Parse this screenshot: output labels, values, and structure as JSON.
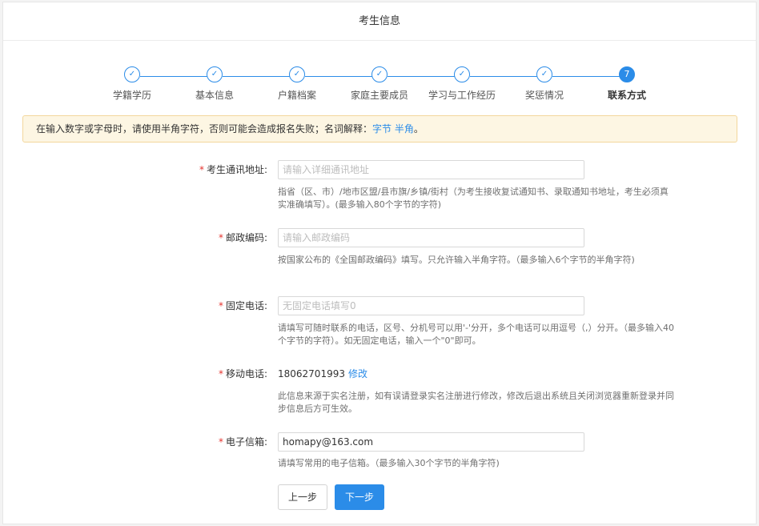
{
  "header": {
    "title": "考生信息"
  },
  "steps": [
    {
      "label": "学籍学历",
      "mark": "✓"
    },
    {
      "label": "基本信息",
      "mark": "✓"
    },
    {
      "label": "户籍档案",
      "mark": "✓"
    },
    {
      "label": "家庭主要成员",
      "mark": "✓"
    },
    {
      "label": "学习与工作经历",
      "mark": "✓"
    },
    {
      "label": "奖惩情况",
      "mark": "✓"
    },
    {
      "label": "联系方式",
      "mark": "7"
    }
  ],
  "notice": {
    "text": "在输入数字或字母时，请使用半角字符，否则可能会造成报名失败；名词解释：",
    "link1": "字节",
    "link2": "半角",
    "end": "。"
  },
  "form": {
    "required_mark": "*",
    "address": {
      "label": "考生通讯地址:",
      "placeholder": "请输入详细通讯地址",
      "hint": "指省（区、市）/地市区盟/县市旗/乡镇/街村（为考生接收复试通知书、录取通知书地址，考生必须真实准确填写）。(最多输入80个字节的字符)"
    },
    "postcode": {
      "label": "邮政编码:",
      "placeholder": "请输入邮政编码",
      "hint": "按国家公布的《全国邮政编码》填写。只允许输入半角字符。（最多输入6个字节的半角字符)"
    },
    "phone": {
      "label": "固定电话:",
      "placeholder": "无固定电话填写0",
      "hint": "请填写可随时联系的电话，区号、分机号可以用'-'分开，多个电话可以用逗号（,）分开。（最多输入40个字节的字符）。如无固定电话，输入一个\"0\"即可。"
    },
    "mobile": {
      "label": "移动电话:",
      "value": "18062701993",
      "edit": "修改",
      "hint": "此信息来源于实名注册，如有误请登录实名注册进行修改，修改后退出系统且关闭浏览器重新登录并同步信息后方可生效。"
    },
    "email": {
      "label": "电子信箱:",
      "value": "homapy@163.com",
      "hint": "请填写常用的电子信箱。（最多输入30个字节的半角字符)"
    }
  },
  "buttons": {
    "prev": "上一步",
    "next": "下一步"
  },
  "colors": {
    "accent": "#2b8ce8",
    "required": "#e5322d",
    "notice_bg": "#fdf6e3"
  }
}
